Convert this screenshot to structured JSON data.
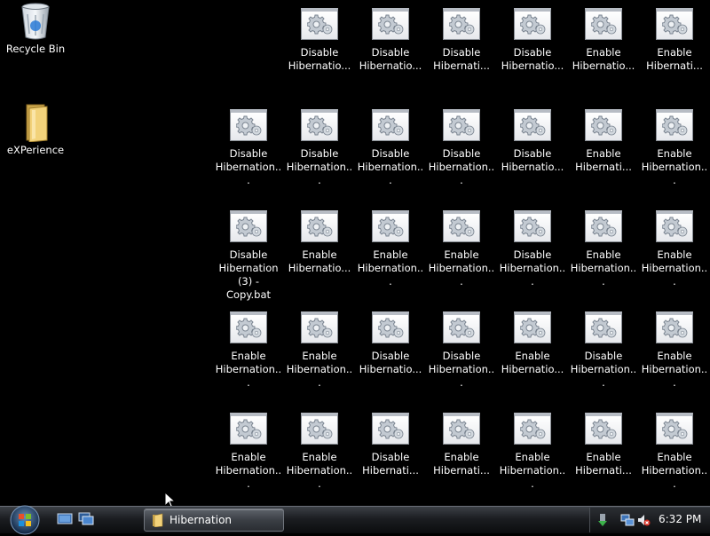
{
  "desktop": {
    "recycle_bin_label": "Recycle Bin",
    "experience_label": "eXPerience",
    "files": [
      [
        "Disable\nHibernatio...",
        "Disable\nHibernatio...",
        "Disable\nHibernati...",
        "Disable\nHibernatio...",
        "Enable\nHibernatio...",
        "Enable\nHibernati..."
      ],
      [
        "Disable\nHibernation...",
        "Disable\nHibernation...",
        "Disable\nHibernation...",
        "Disable\nHibernation...",
        "Disable\nHibernatio...",
        "Enable\nHibernati...",
        "Enable\nHibernation..."
      ],
      [
        "Disable\nHibernation\n(3) - Copy.bat",
        "Enable\nHibernatio...",
        "Enable\nHibernation...",
        "Enable\nHibernation...",
        "Disable\nHibernation...",
        "Enable\nHibernation...",
        "Enable\nHibernation..."
      ],
      [
        "Enable\nHibernation...",
        "Enable\nHibernation...",
        "Disable\nHibernatio...",
        "Disable\nHibernation...",
        "Enable\nHibernatio...",
        "Disable\nHibernation...",
        "Enable\nHibernation..."
      ],
      [
        "Enable\nHibernation...",
        "Enable\nHibernation...",
        "Disable\nHibernati...",
        "Enable\nHibernati...",
        "Enable\nHibernation...",
        "Enable\nHibernati...",
        "Enable\nHibernation..."
      ]
    ]
  },
  "taskbar": {
    "start_icon": "windows-orb-icon",
    "quick_launch": [
      "show-desktop-icon",
      "switch-windows-icon"
    ],
    "task_button_label": "Hibernation",
    "clock": "6:32 PM",
    "tray_icons": [
      "safely-remove-icon",
      "network-icon",
      "volume-muted-icon"
    ]
  },
  "colors": {
    "desktop_background": "#000000",
    "taskbar_background": "#1b1d21"
  }
}
